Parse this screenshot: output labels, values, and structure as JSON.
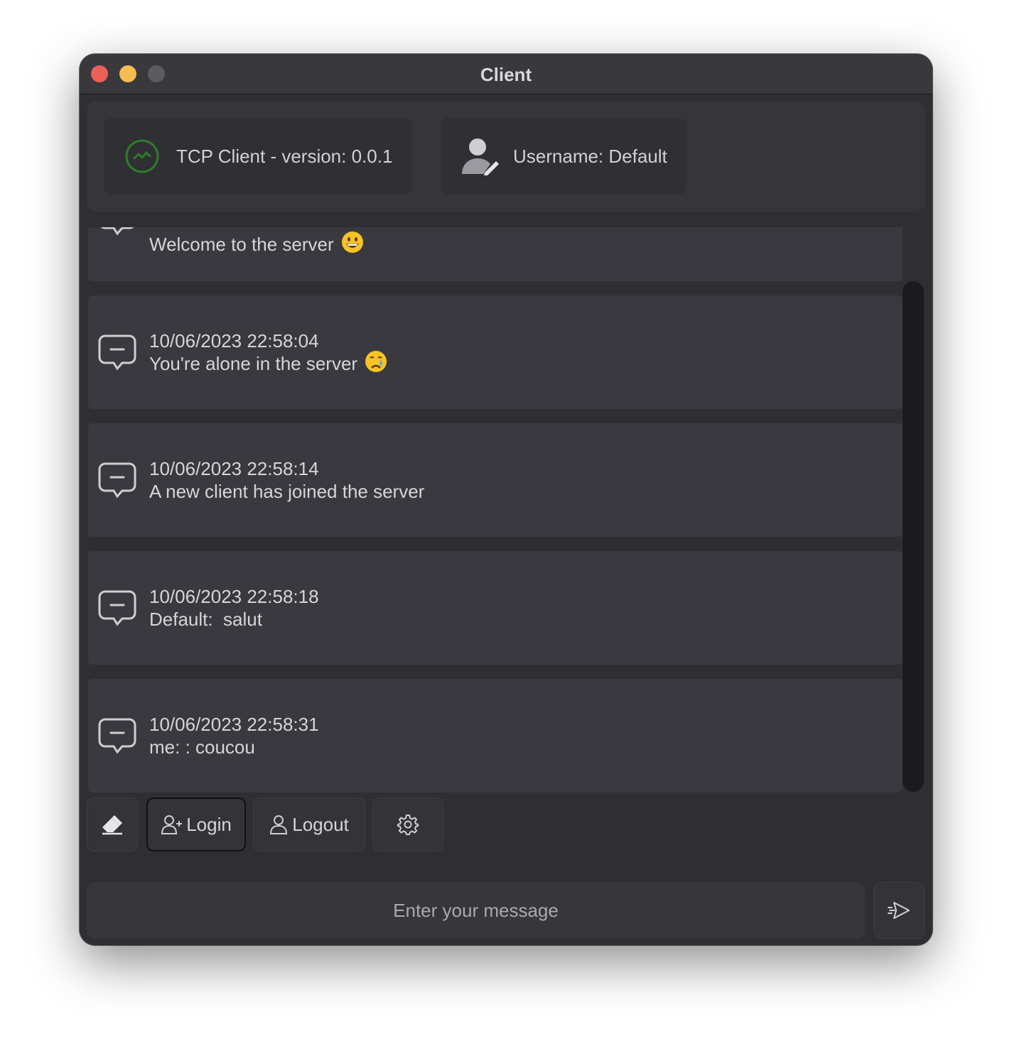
{
  "window": {
    "title": "Client"
  },
  "header": {
    "version_label": "TCP Client - version: 0.0.1",
    "version_icon": "activity-icon",
    "username_label": "Username: Default",
    "username_icon": "user-edit-icon",
    "accent_green": "#2f8f2f"
  },
  "messages": [
    {
      "timestamp": "",
      "text": "Welcome to the server",
      "emoji": "grinning-face"
    },
    {
      "timestamp": "10/06/2023 22:58:04",
      "text": "You're alone in the server",
      "emoji": "crying-face"
    },
    {
      "timestamp": "10/06/2023 22:58:14",
      "text": "A new client has joined the server",
      "emoji": ""
    },
    {
      "timestamp": "10/06/2023 22:58:18",
      "text": "Default:  salut",
      "emoji": ""
    },
    {
      "timestamp": "10/06/2023 22:58:31",
      "text": "me: : coucou",
      "emoji": ""
    }
  ],
  "toolbar": {
    "clear_icon": "eraser-icon",
    "login_label": "Login",
    "logout_label": "Logout",
    "settings_icon": "gear-icon"
  },
  "composer": {
    "placeholder": "Enter your message",
    "value": "",
    "send_icon": "send-icon"
  }
}
